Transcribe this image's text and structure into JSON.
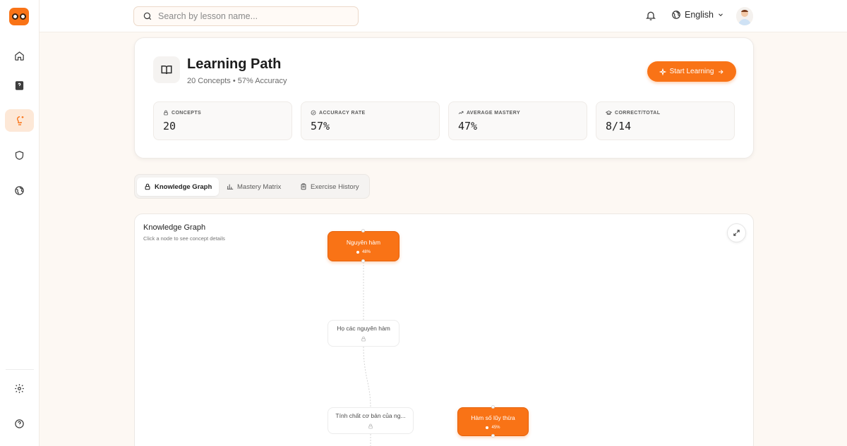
{
  "sidebar": {
    "items": [
      {
        "name": "home",
        "icon": "home-icon"
      },
      {
        "name": "lessons",
        "icon": "book-question-icon"
      },
      {
        "name": "learning-path",
        "icon": "brain-sparkle-icon",
        "active": true
      },
      {
        "name": "shield",
        "icon": "shield-icon"
      },
      {
        "name": "explore",
        "icon": "globe-icon"
      }
    ],
    "bottom": [
      {
        "name": "settings",
        "icon": "gear-icon"
      },
      {
        "name": "help",
        "icon": "help-circle-icon"
      }
    ]
  },
  "header": {
    "search_placeholder": "Search by lesson name...",
    "language": "English"
  },
  "learning_path": {
    "title": "Learning Path",
    "concepts_text": "20 Concepts",
    "separator": "•",
    "accuracy_text": "57% Accuracy",
    "start_button": "Start Learning",
    "stats": [
      {
        "label": "CONCEPTS",
        "value": "20",
        "icon": "lock-icon"
      },
      {
        "label": "ACCURACY RATE",
        "value": "57%",
        "icon": "check-circle-icon"
      },
      {
        "label": "AVERAGE MASTERY",
        "value": "47%",
        "icon": "trending-up-icon"
      },
      {
        "label": "CORRECT/TOTAL",
        "value": "8/14",
        "icon": "graduation-cap-icon"
      }
    ]
  },
  "tabs": [
    {
      "label": "Knowledge Graph",
      "icon": "lock-icon",
      "active": true
    },
    {
      "label": "Mastery Matrix",
      "icon": "bar-chart-icon",
      "active": false
    },
    {
      "label": "Exercise History",
      "icon": "clipboard-icon",
      "active": false
    }
  ],
  "graph": {
    "title": "Knowledge Graph",
    "subtitle": "Click a node to see concept details",
    "accent": "#f97316",
    "nodes": [
      {
        "label": "Nguyên hàm",
        "mastery": "48%",
        "state": "mastered"
      },
      {
        "label": "Họ các nguyên hàm",
        "state": "locked"
      },
      {
        "label": "Tính chất cơ bản của ng...",
        "state": "locked"
      },
      {
        "label": "Hàm số lũy thừa",
        "mastery": "45%",
        "state": "mastered"
      }
    ]
  }
}
